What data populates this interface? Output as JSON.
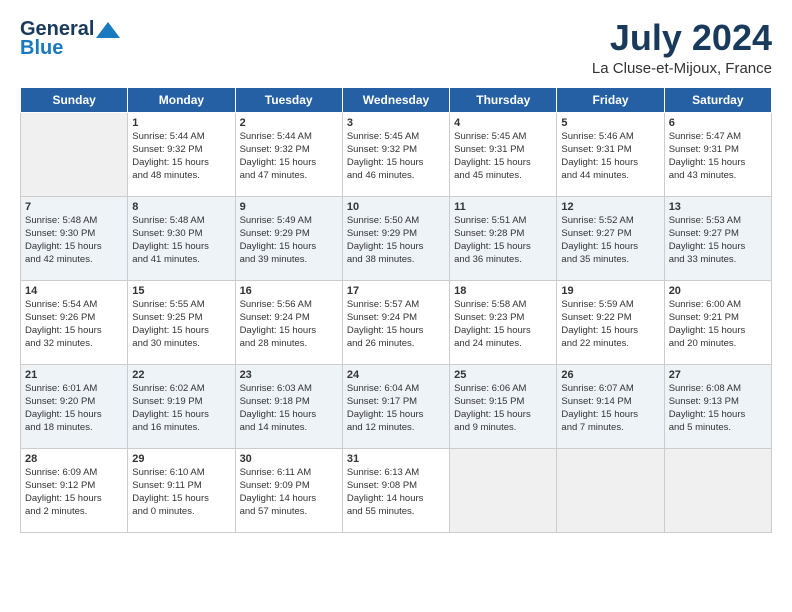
{
  "logo": {
    "line1": "General",
    "line2": "Blue"
  },
  "title": "July 2024",
  "subtitle": "La Cluse-et-Mijoux, France",
  "days_of_week": [
    "Sunday",
    "Monday",
    "Tuesday",
    "Wednesday",
    "Thursday",
    "Friday",
    "Saturday"
  ],
  "weeks": [
    [
      {
        "day": "",
        "content": ""
      },
      {
        "day": "1",
        "content": "Sunrise: 5:44 AM\nSunset: 9:32 PM\nDaylight: 15 hours\nand 48 minutes."
      },
      {
        "day": "2",
        "content": "Sunrise: 5:44 AM\nSunset: 9:32 PM\nDaylight: 15 hours\nand 47 minutes."
      },
      {
        "day": "3",
        "content": "Sunrise: 5:45 AM\nSunset: 9:32 PM\nDaylight: 15 hours\nand 46 minutes."
      },
      {
        "day": "4",
        "content": "Sunrise: 5:45 AM\nSunset: 9:31 PM\nDaylight: 15 hours\nand 45 minutes."
      },
      {
        "day": "5",
        "content": "Sunrise: 5:46 AM\nSunset: 9:31 PM\nDaylight: 15 hours\nand 44 minutes."
      },
      {
        "day": "6",
        "content": "Sunrise: 5:47 AM\nSunset: 9:31 PM\nDaylight: 15 hours\nand 43 minutes."
      }
    ],
    [
      {
        "day": "7",
        "content": "Sunrise: 5:48 AM\nSunset: 9:30 PM\nDaylight: 15 hours\nand 42 minutes."
      },
      {
        "day": "8",
        "content": "Sunrise: 5:48 AM\nSunset: 9:30 PM\nDaylight: 15 hours\nand 41 minutes."
      },
      {
        "day": "9",
        "content": "Sunrise: 5:49 AM\nSunset: 9:29 PM\nDaylight: 15 hours\nand 39 minutes."
      },
      {
        "day": "10",
        "content": "Sunrise: 5:50 AM\nSunset: 9:29 PM\nDaylight: 15 hours\nand 38 minutes."
      },
      {
        "day": "11",
        "content": "Sunrise: 5:51 AM\nSunset: 9:28 PM\nDaylight: 15 hours\nand 36 minutes."
      },
      {
        "day": "12",
        "content": "Sunrise: 5:52 AM\nSunset: 9:27 PM\nDaylight: 15 hours\nand 35 minutes."
      },
      {
        "day": "13",
        "content": "Sunrise: 5:53 AM\nSunset: 9:27 PM\nDaylight: 15 hours\nand 33 minutes."
      }
    ],
    [
      {
        "day": "14",
        "content": "Sunrise: 5:54 AM\nSunset: 9:26 PM\nDaylight: 15 hours\nand 32 minutes."
      },
      {
        "day": "15",
        "content": "Sunrise: 5:55 AM\nSunset: 9:25 PM\nDaylight: 15 hours\nand 30 minutes."
      },
      {
        "day": "16",
        "content": "Sunrise: 5:56 AM\nSunset: 9:24 PM\nDaylight: 15 hours\nand 28 minutes."
      },
      {
        "day": "17",
        "content": "Sunrise: 5:57 AM\nSunset: 9:24 PM\nDaylight: 15 hours\nand 26 minutes."
      },
      {
        "day": "18",
        "content": "Sunrise: 5:58 AM\nSunset: 9:23 PM\nDaylight: 15 hours\nand 24 minutes."
      },
      {
        "day": "19",
        "content": "Sunrise: 5:59 AM\nSunset: 9:22 PM\nDaylight: 15 hours\nand 22 minutes."
      },
      {
        "day": "20",
        "content": "Sunrise: 6:00 AM\nSunset: 9:21 PM\nDaylight: 15 hours\nand 20 minutes."
      }
    ],
    [
      {
        "day": "21",
        "content": "Sunrise: 6:01 AM\nSunset: 9:20 PM\nDaylight: 15 hours\nand 18 minutes."
      },
      {
        "day": "22",
        "content": "Sunrise: 6:02 AM\nSunset: 9:19 PM\nDaylight: 15 hours\nand 16 minutes."
      },
      {
        "day": "23",
        "content": "Sunrise: 6:03 AM\nSunset: 9:18 PM\nDaylight: 15 hours\nand 14 minutes."
      },
      {
        "day": "24",
        "content": "Sunrise: 6:04 AM\nSunset: 9:17 PM\nDaylight: 15 hours\nand 12 minutes."
      },
      {
        "day": "25",
        "content": "Sunrise: 6:06 AM\nSunset: 9:15 PM\nDaylight: 15 hours\nand 9 minutes."
      },
      {
        "day": "26",
        "content": "Sunrise: 6:07 AM\nSunset: 9:14 PM\nDaylight: 15 hours\nand 7 minutes."
      },
      {
        "day": "27",
        "content": "Sunrise: 6:08 AM\nSunset: 9:13 PM\nDaylight: 15 hours\nand 5 minutes."
      }
    ],
    [
      {
        "day": "28",
        "content": "Sunrise: 6:09 AM\nSunset: 9:12 PM\nDaylight: 15 hours\nand 2 minutes."
      },
      {
        "day": "29",
        "content": "Sunrise: 6:10 AM\nSunset: 9:11 PM\nDaylight: 15 hours\nand 0 minutes."
      },
      {
        "day": "30",
        "content": "Sunrise: 6:11 AM\nSunset: 9:09 PM\nDaylight: 14 hours\nand 57 minutes."
      },
      {
        "day": "31",
        "content": "Sunrise: 6:13 AM\nSunset: 9:08 PM\nDaylight: 14 hours\nand 55 minutes."
      },
      {
        "day": "",
        "content": ""
      },
      {
        "day": "",
        "content": ""
      },
      {
        "day": "",
        "content": ""
      }
    ]
  ]
}
